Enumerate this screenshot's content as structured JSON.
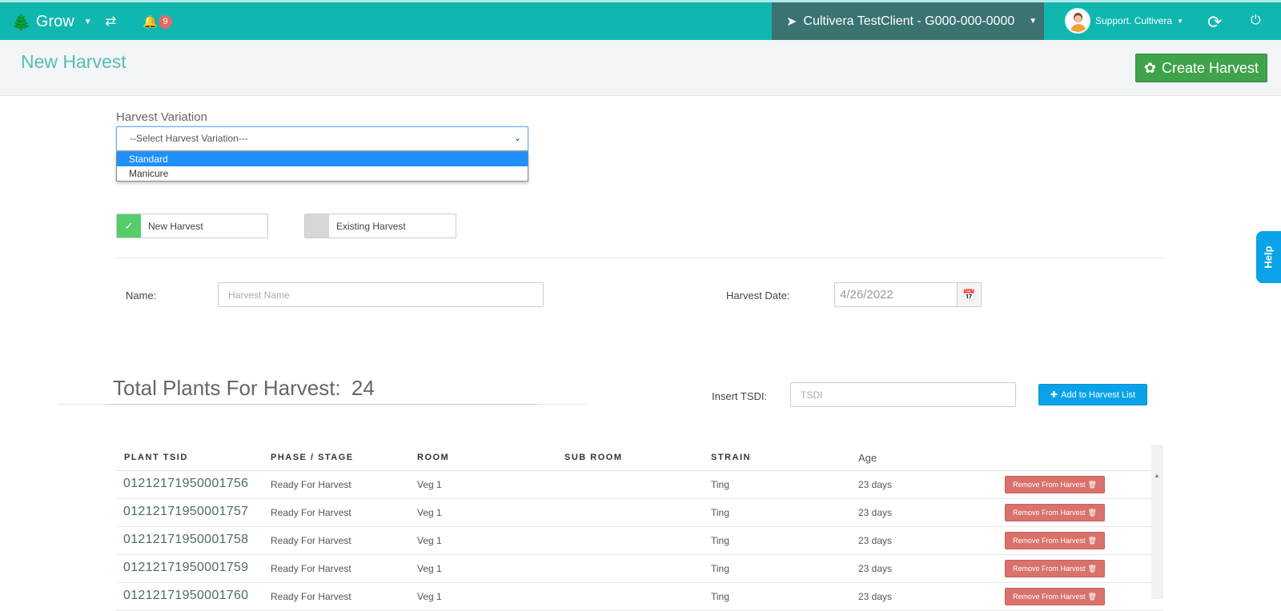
{
  "nav": {
    "brand": "Grow",
    "notification_count": "9",
    "location": "Cultivera TestClient - G000-000-0000",
    "user": "Support. Cultivera",
    "icons": [
      "tree-icon",
      "exchange-icon",
      "bell-icon",
      "location-arrow-icon",
      "refresh-icon",
      "power-icon"
    ]
  },
  "header": {
    "title": "New Harvest",
    "create_label": "Create Harvest"
  },
  "form": {
    "variation_label": "Harvest Variation",
    "variation_placeholder": "--Select Harvest Variation---",
    "variation_options": [
      "Standard",
      "Manicure"
    ],
    "toggle_new": "New Harvest",
    "toggle_existing": "Existing Harvest",
    "name_label": "Name:",
    "name_placeholder": "Harvest Name",
    "date_label": "Harvest Date:",
    "date_value": "4/26/2022",
    "total_label": "Total Plants For Harvest:",
    "total_value": "24",
    "tsdi_label": "Insert TSDI:",
    "tsdi_placeholder": "TSDI",
    "add_label": "Add to Harvest List"
  },
  "table": {
    "columns": [
      "PLANT TSID",
      "PHASE / STAGE",
      "ROOM",
      "SUB ROOM",
      "STRAIN",
      "Age"
    ],
    "remove_label": "Remove From Harvest",
    "rows": [
      {
        "tsid": "01212171950001756",
        "phase": "Ready For Harvest",
        "room": "Veg 1",
        "subroom": "",
        "strain": "Ting",
        "age": "23 days"
      },
      {
        "tsid": "01212171950001757",
        "phase": "Ready For Harvest",
        "room": "Veg 1",
        "subroom": "",
        "strain": "Ting",
        "age": "23 days"
      },
      {
        "tsid": "01212171950001758",
        "phase": "Ready For Harvest",
        "room": "Veg 1",
        "subroom": "",
        "strain": "Ting",
        "age": "23 days"
      },
      {
        "tsid": "01212171950001759",
        "phase": "Ready For Harvest",
        "room": "Veg 1",
        "subroom": "",
        "strain": "Ting",
        "age": "23 days"
      },
      {
        "tsid": "01212171950001760",
        "phase": "Ready For Harvest",
        "room": "Veg 1",
        "subroom": "",
        "strain": "Ting",
        "age": "23 days"
      }
    ]
  },
  "help": {
    "label": "Help"
  },
  "colors": {
    "nav": "#0fb7b0",
    "location": "#3a7371",
    "create": "#3ea34a",
    "remove": "#d9726b",
    "add": "#0aa2e8",
    "title": "#52bfb7"
  }
}
